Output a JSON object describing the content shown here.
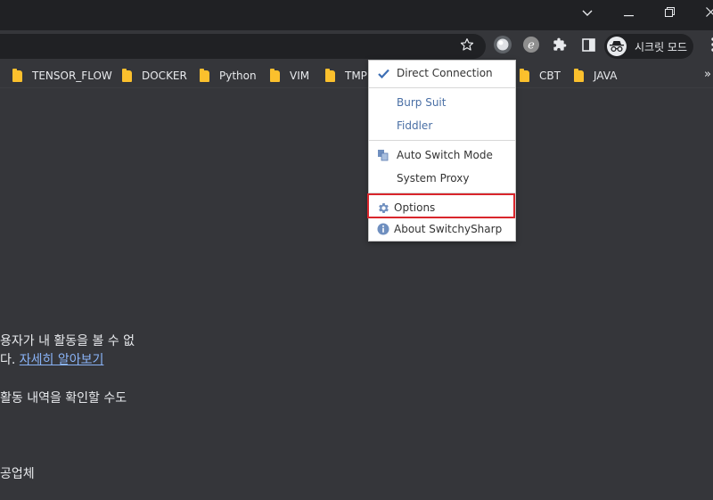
{
  "browser": {
    "bookmarks": [
      "TENSOR_FLOW",
      "DOCKER",
      "Python",
      "VIM",
      "TMP",
      "CBT",
      "JAVA"
    ],
    "bookmarks_overflow": "»",
    "profile_label": "시크릿 모드"
  },
  "page": {
    "line1": "용자가 내 활동을 볼 수 없",
    "line2_prefix": "다.",
    "line2_link": "자세히 알아보기",
    "line3": "활동 내역을 확인할 수도",
    "line4": "공업체"
  },
  "popup": {
    "direct": "Direct Connection",
    "proxies": [
      "Burp Suit",
      "Fiddler"
    ],
    "auto_switch": "Auto Switch Mode",
    "system_proxy": "System Proxy",
    "options": "Options",
    "about": "About SwitchySharp"
  },
  "colors": {
    "highlight": "#d9262c",
    "bookmark_folder": "#fbc02d",
    "link": "#8ab4f8"
  }
}
